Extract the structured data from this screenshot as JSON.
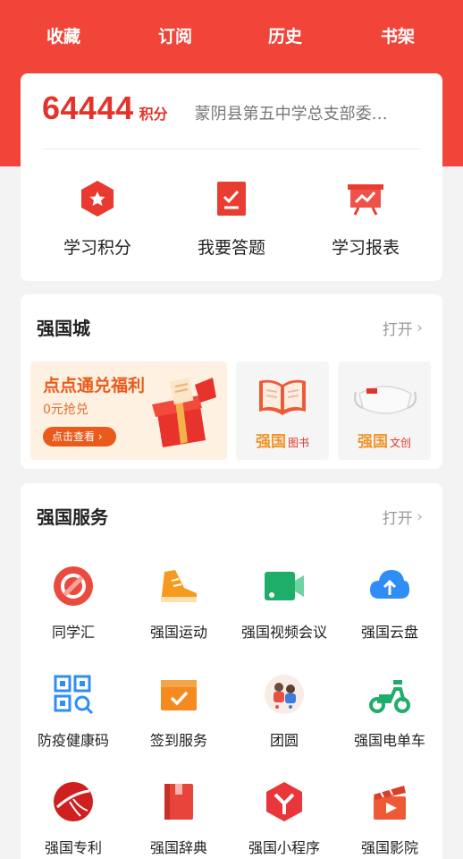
{
  "topnav": [
    "收藏",
    "订阅",
    "历史",
    "书架"
  ],
  "points": {
    "value": "64444",
    "unit": "积分",
    "org": "蒙阴县第五中学总支部委…"
  },
  "quick_actions": [
    {
      "label": "学习积分",
      "icon": "points-badge-icon"
    },
    {
      "label": "我要答题",
      "icon": "quiz-checklist-icon"
    },
    {
      "label": "学习报表",
      "icon": "report-chart-icon"
    }
  ],
  "mall": {
    "title": "强国城",
    "open": "打开",
    "promo": {
      "title": "点点通兑福利",
      "sub": "0元抢兑",
      "button": "点击查看 ›"
    },
    "tiles": [
      {
        "brand": "强国",
        "sub": "图书",
        "icon": "book-icon"
      },
      {
        "brand": "强国",
        "sub": "文创",
        "icon": "mask-icon"
      }
    ]
  },
  "services": {
    "title": "强国服务",
    "open": "打开",
    "items": [
      {
        "label": "同学汇",
        "icon": "classmates-icon"
      },
      {
        "label": "强国运动",
        "icon": "sneaker-icon"
      },
      {
        "label": "强国视频会议",
        "icon": "video-conference-icon"
      },
      {
        "label": "强国云盘",
        "icon": "cloud-upload-icon"
      },
      {
        "label": "防疫健康码",
        "icon": "qr-code-icon"
      },
      {
        "label": "签到服务",
        "icon": "checkin-icon"
      },
      {
        "label": "团圆",
        "icon": "reunion-icon"
      },
      {
        "label": "强国电单车",
        "icon": "e-scooter-icon"
      },
      {
        "label": "强国专利",
        "icon": "patent-icon"
      },
      {
        "label": "强国辞典",
        "icon": "dictionary-icon"
      },
      {
        "label": "强国小程序",
        "icon": "mini-program-icon"
      },
      {
        "label": "强国影院",
        "icon": "cinema-icon"
      }
    ]
  },
  "colors": {
    "brand_red": "#f2453a",
    "points_red": "#e3342b",
    "muted": "#999999"
  }
}
